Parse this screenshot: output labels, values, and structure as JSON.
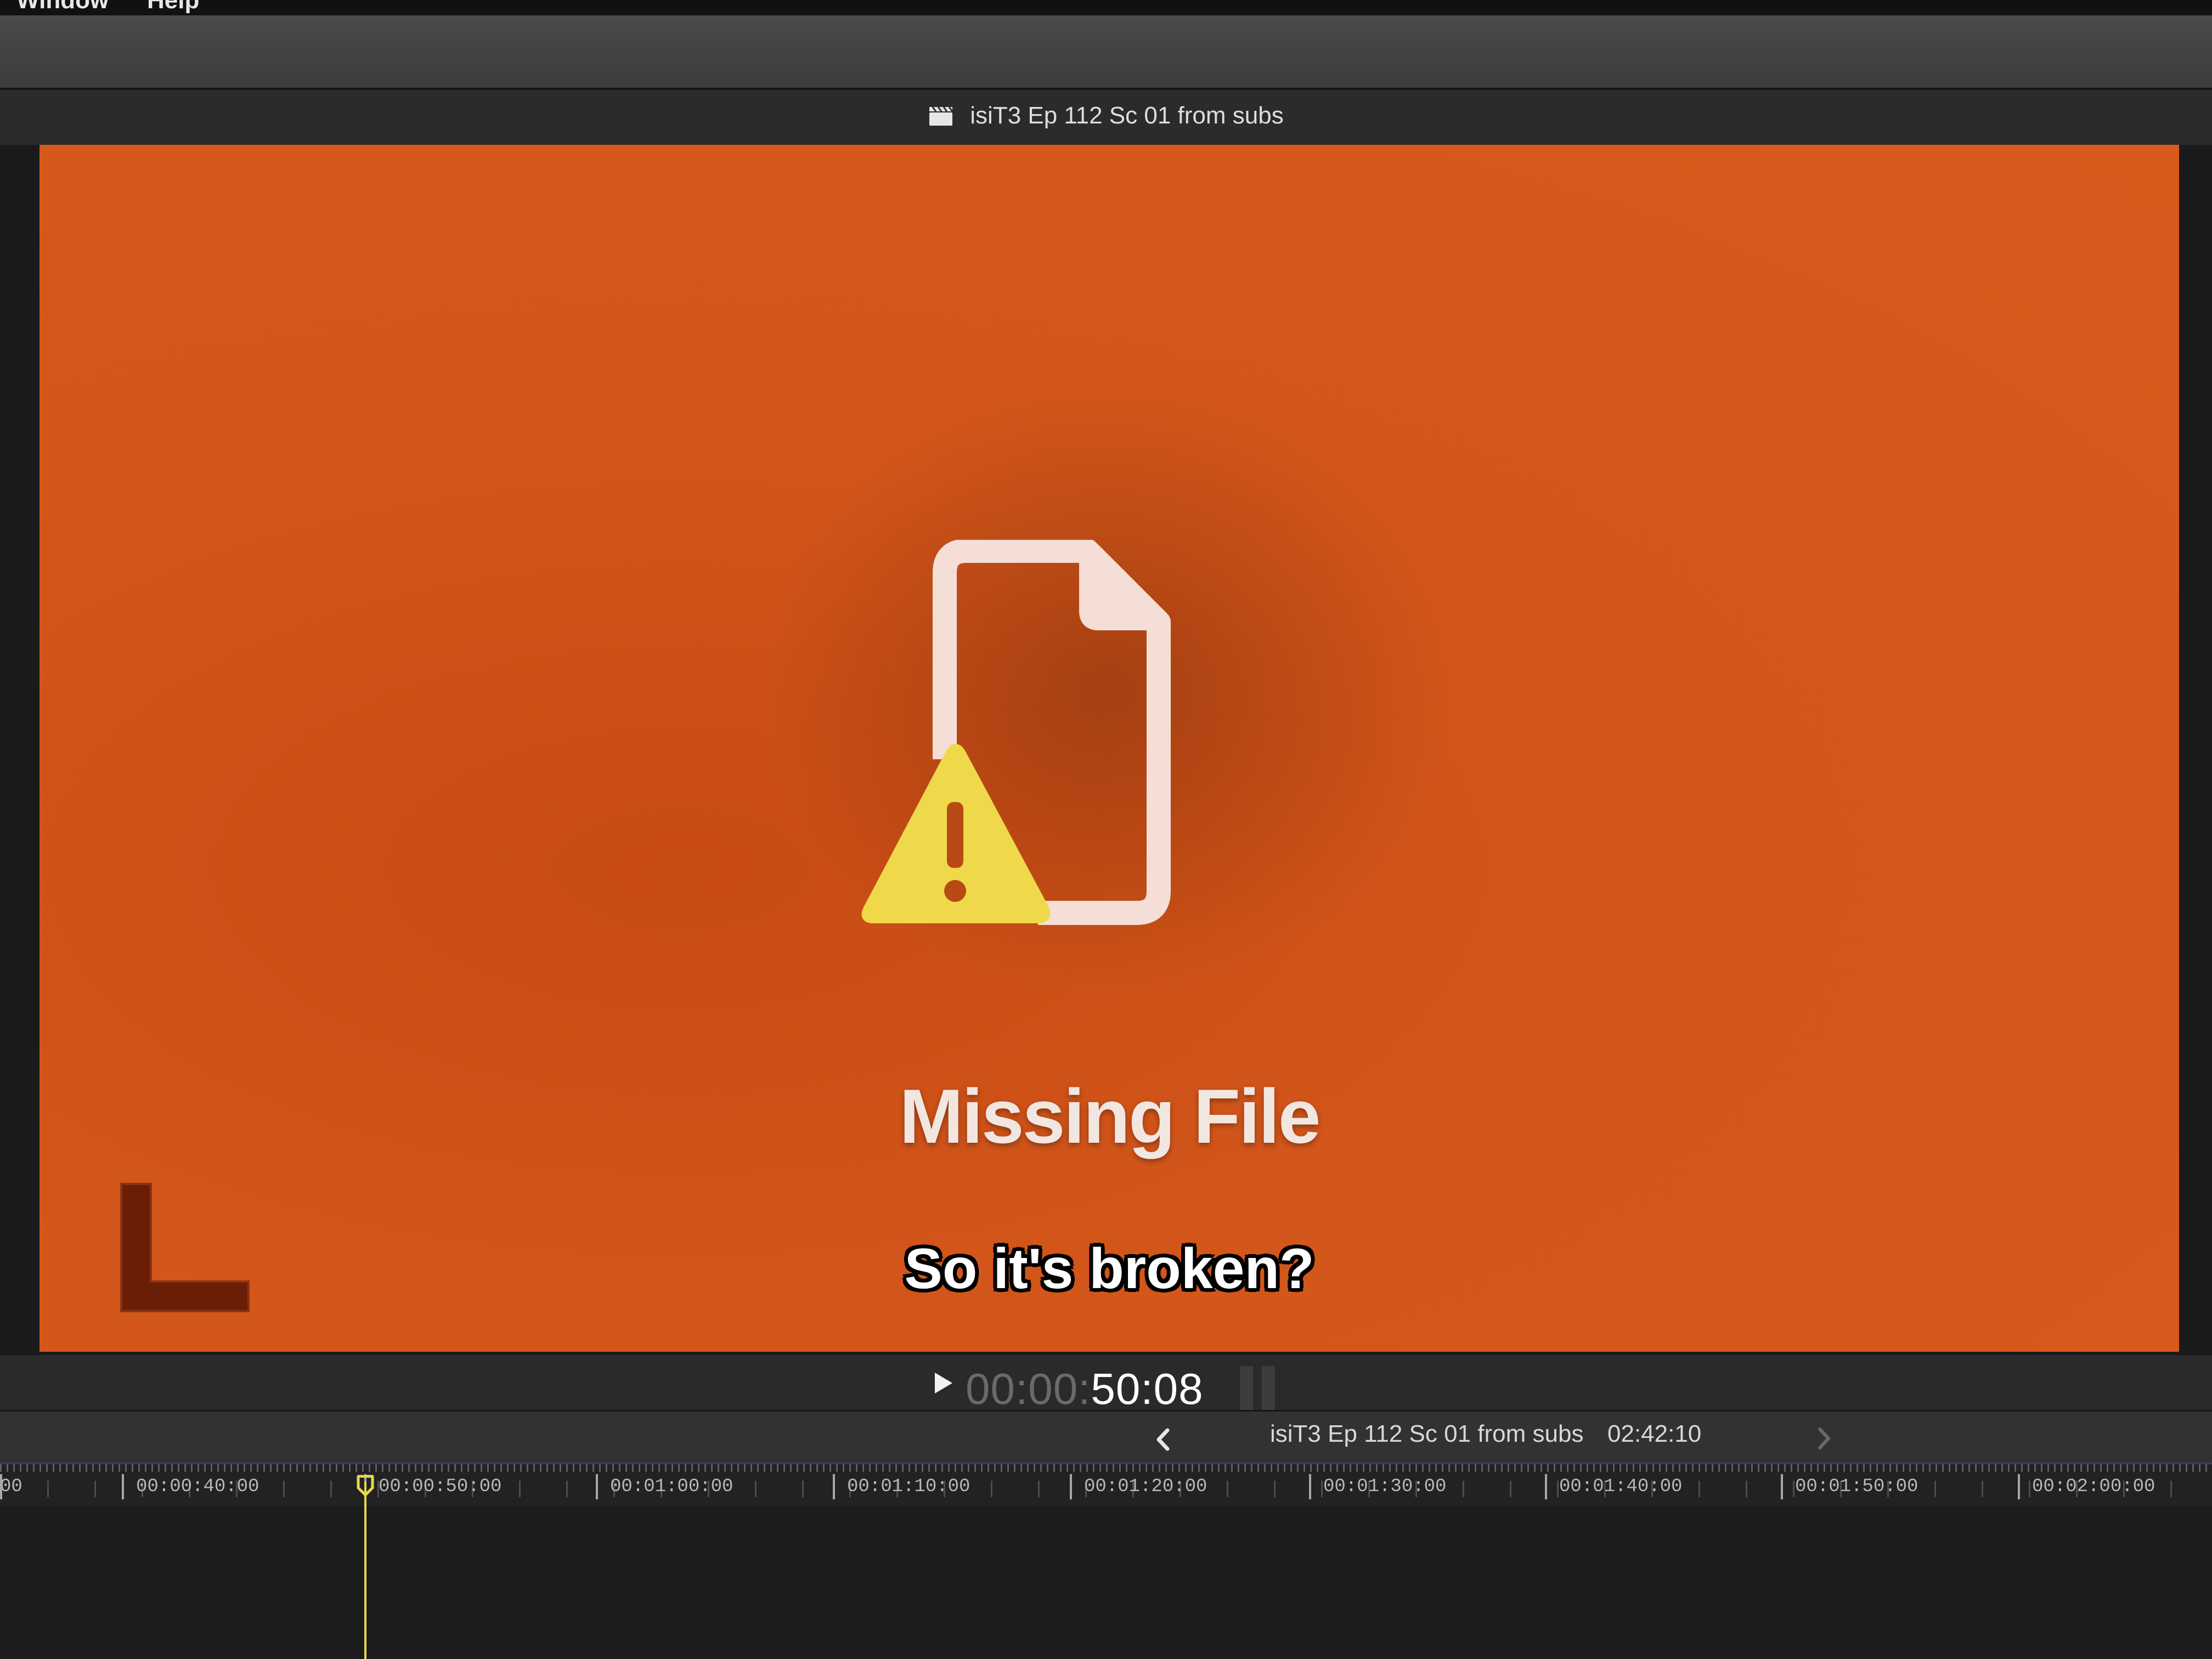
{
  "menubar": {
    "items": [
      "Window",
      "Help"
    ]
  },
  "viewer": {
    "title": "isiT3 Ep 112 Sc 01 from subs",
    "missing_title": "Missing File",
    "subtitle": "So it's broken?",
    "timecode_dim": "00:00:",
    "timecode_bright": "50:08"
  },
  "timeline": {
    "project_title": "isiT3 Ep 112 Sc 01 from subs",
    "duration": "02:42:10",
    "ruler_labels": [
      "00:00:40:00",
      "00:00:50:00",
      "00:01:00:00",
      "00:01:10:00",
      "00:01:20:00",
      "00:01:30:00",
      "00:01:40:00",
      "00:01:50:00",
      "00:02:00:00"
    ],
    "ruler_left_fragment": "00"
  },
  "colors": {
    "frame_orange": "#d9581b",
    "warning_yellow": "#efd94a",
    "playhead": "#e9d84a"
  },
  "icons": {
    "title_icon": "clapperboard-icon",
    "missing_icon": "missing-file-warning-icon",
    "play": "play-icon",
    "back": "chevron-left-icon",
    "forward": "chevron-right-icon"
  }
}
